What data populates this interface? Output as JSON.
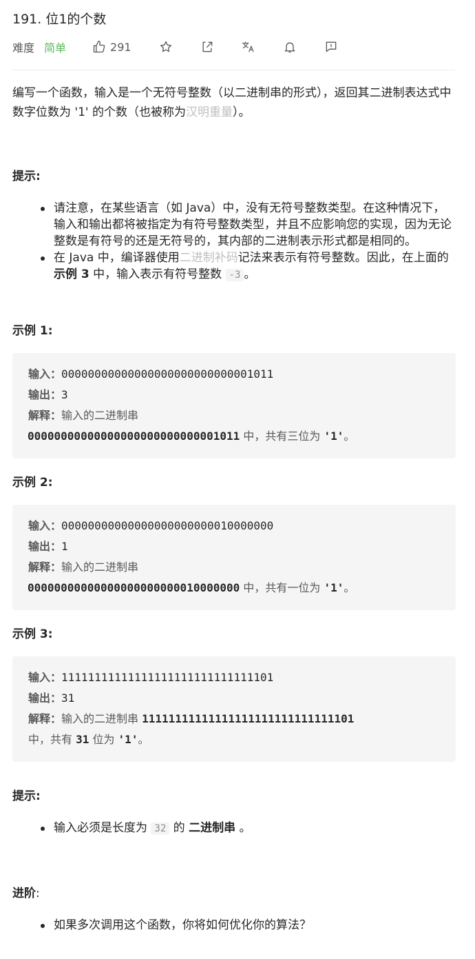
{
  "problem": {
    "title": "191. 位1的个数",
    "difficulty_label": "难度",
    "difficulty": "简单",
    "likes": "291",
    "accent_color": "#5cb85c"
  },
  "toolbar": {
    "icons": [
      "thumbs-up-icon",
      "star-icon",
      "share-icon",
      "translate-icon",
      "bell-icon",
      "feedback-icon"
    ]
  },
  "description": {
    "text_before": "编写一个函数，输入是一个无符号整数（以二进制串的形式），返回其二进制表达式中数字位数为 '1' 的个数（也被称为",
    "link": "汉明重量",
    "text_after": "）。"
  },
  "hints": {
    "heading": "提示",
    "colon": ":",
    "item1": "请注意，在某些语言（如 Java）中，没有无符号整数类型。在这种情况下，输入和输出都将被指定为有符号整数类型，并且不应影响您的实现，因为无论整数是有符号的还是无符号的，其内部的二进制表示形式都是相同的。",
    "item2_a": "在 Java 中，编译器使用",
    "item2_link": "二进制补码",
    "item2_b": "记法来表示有符号整数。因此，在上面的 ",
    "item2_bold": "示例 3",
    "item2_c": " 中，输入表示有符号整数 ",
    "item2_code": "-3",
    "item2_d": "。"
  },
  "examples": [
    {
      "heading": "示例 1",
      "input_label": "输入：",
      "input": "00000000000000000000000000001011",
      "output_label": "输出：",
      "output": "3",
      "explain_label": "解释：",
      "explain_text": "输入的二进制串",
      "explain_bits": "00000000000000000000000000001011",
      "explain_mid": " 中，共有三位为 ",
      "explain_quote": "'1'",
      "explain_end": "。"
    },
    {
      "heading": "示例 2",
      "input_label": "输入：",
      "input": "00000000000000000000000010000000",
      "output_label": "输出：",
      "output": "1",
      "explain_label": "解释：",
      "explain_text": "输入的二进制串",
      "explain_bits": "00000000000000000000000010000000",
      "explain_mid": " 中，共有一位为 ",
      "explain_quote": "'1'",
      "explain_end": "。"
    },
    {
      "heading": "示例 3",
      "input_label": "输入：",
      "input": "11111111111111111111111111111101",
      "output_label": "输出：",
      "output": "31",
      "explain_label": "解释：",
      "explain_text": "输入的二进制串 ",
      "explain_bits": "11111111111111111111111111111101",
      "explain_line2_a": "中，共有 ",
      "explain_count": "31",
      "explain_line2_b": " 位为 ",
      "explain_quote": "'1'",
      "explain_end": "。"
    }
  ],
  "constraints": {
    "heading": "提示",
    "colon": ":",
    "item_a": "输入必须是长度为 ",
    "item_code": "32",
    "item_b": " 的 ",
    "item_bold": "二进制串",
    "item_c": " 。"
  },
  "advanced": {
    "heading": "进阶",
    "colon": ":",
    "item": "如果多次调用这个函数，你将如何优化你的算法？"
  }
}
